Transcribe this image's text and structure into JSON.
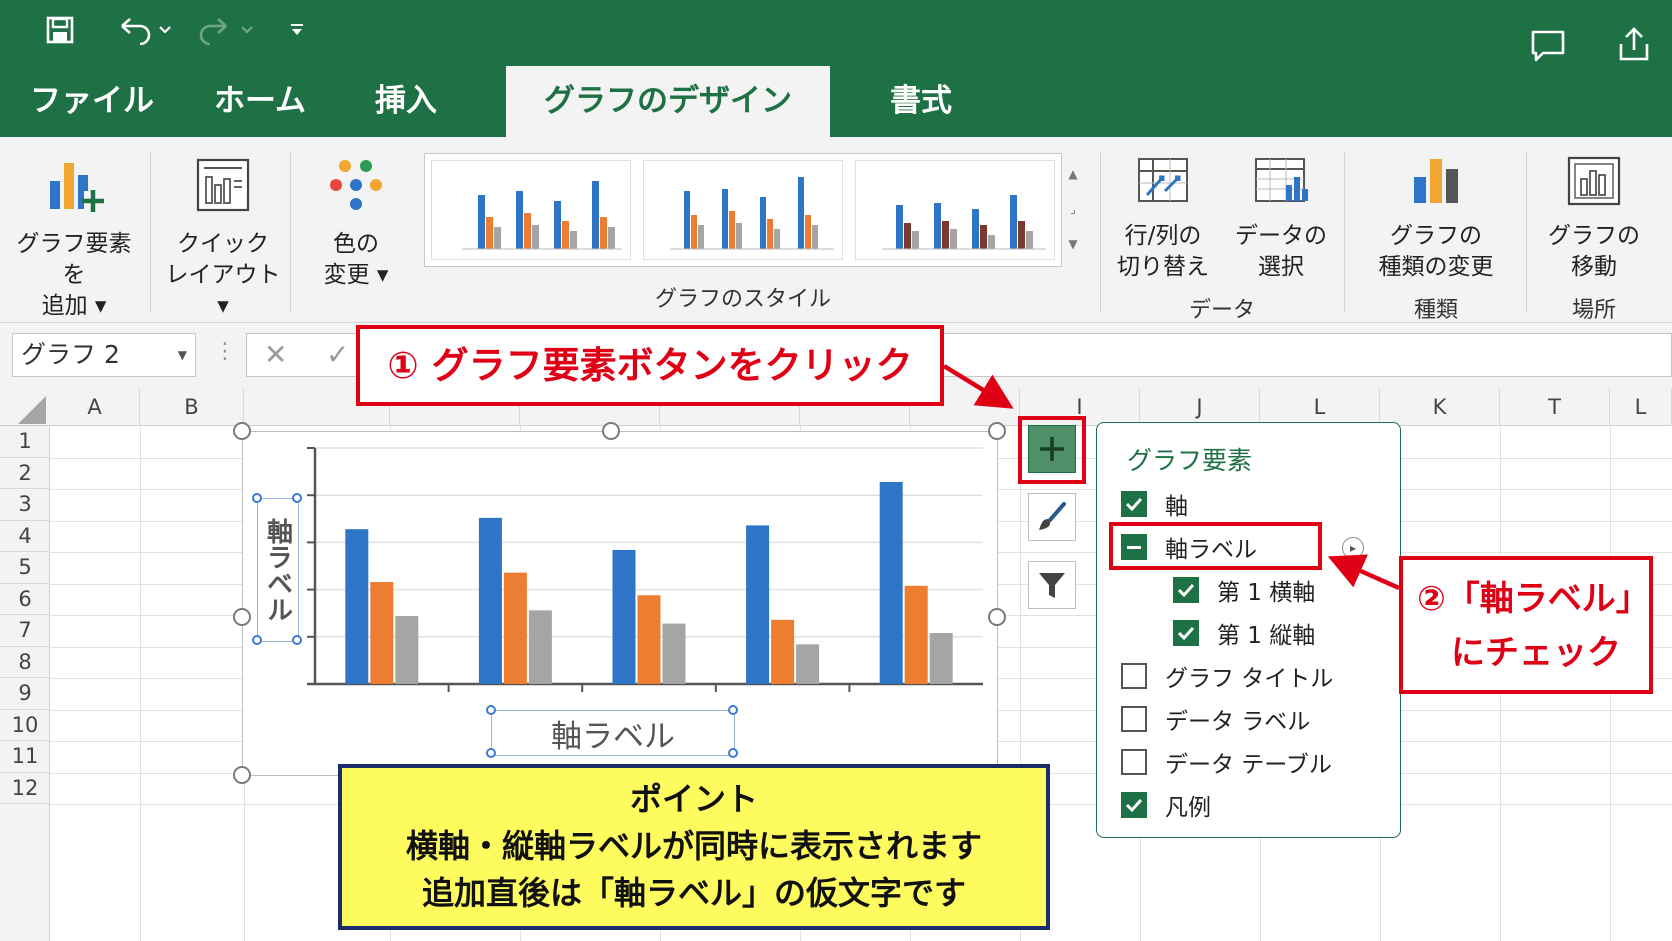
{
  "colors": {
    "excel_green": "#1e7145",
    "series_blue": "#2e75c7",
    "series_orange": "#ed7d31",
    "series_gray": "#a5a5a5",
    "annotation_red": "#e00016",
    "note_yellow": "#fefb5f",
    "note_border": "#1b2c6b"
  },
  "quick_access": {
    "icons": [
      "save-icon",
      "undo-icon",
      "redo-icon",
      "customize-icon",
      "comment-icon",
      "share-icon"
    ]
  },
  "tabs": [
    {
      "label": "ファイル",
      "active": false
    },
    {
      "label": "ホーム",
      "active": false
    },
    {
      "label": "挿入",
      "active": false
    },
    {
      "label": "グラフのデザイン",
      "active": true
    },
    {
      "label": "書式",
      "active": false
    }
  ],
  "ribbon": {
    "add_element": {
      "line1": "グラフ要素を",
      "line2": "追加 ▾"
    },
    "quick_layout": {
      "line1": "クイック",
      "line2": "レイアウト ▾"
    },
    "change_colors": {
      "line1": "色の",
      "line2": "変更 ▾"
    },
    "styles_group_label": "グラフのスタイル",
    "switch_row_col": {
      "line1": "行/列の",
      "line2": "切り替え"
    },
    "select_data": {
      "line1": "データの",
      "line2": "選択"
    },
    "data_group_label": "データ",
    "change_type": {
      "line1": "グラフの",
      "line2": "種類の変更"
    },
    "type_group_label": "種類",
    "move_chart": {
      "line1": "グラフの",
      "line2": "移動"
    },
    "location_group_label": "場所"
  },
  "formula_bar": {
    "name_box": "グラフ 2",
    "cancel_symbol": "✕",
    "enter_symbol": "✓"
  },
  "sheet": {
    "columns": [
      "A",
      "B",
      "",
      "",
      "",
      "",
      "",
      "",
      "I",
      "J",
      "L",
      "K",
      "T",
      "L"
    ],
    "rows": [
      "1",
      "2",
      "3",
      "4",
      "5",
      "6",
      "7",
      "8",
      "9",
      "10",
      "11",
      "12"
    ]
  },
  "chart": {
    "vertical_axis_label": "軸ラベル",
    "horizontal_axis_label": "軸ラベル"
  },
  "chart_data": {
    "type": "bar",
    "categories": [
      "",
      "",
      "",
      "",
      ""
    ],
    "series": [
      {
        "values": [
          82,
          88,
          71,
          84,
          107
        ]
      },
      {
        "values": [
          54,
          59,
          47,
          34,
          52
        ]
      },
      {
        "values": [
          36,
          39,
          32,
          21,
          27
        ]
      }
    ],
    "ylim": [
      0,
      125
    ],
    "grid": true,
    "legend": "none"
  },
  "chart_elements_panel": {
    "title": "グラフ要素",
    "options": [
      {
        "label": "軸",
        "state": "checked",
        "indent": 0
      },
      {
        "label": "軸ラベル",
        "state": "mixed",
        "indent": 0
      },
      {
        "label": "第 1 横軸",
        "state": "checked",
        "indent": 1
      },
      {
        "label": "第 1 縦軸",
        "state": "checked",
        "indent": 1
      },
      {
        "label": "グラフ タイトル",
        "state": "unchecked",
        "indent": 0
      },
      {
        "label": "データ ラベル",
        "state": "unchecked",
        "indent": 0
      },
      {
        "label": "データ テーブル",
        "state": "unchecked",
        "indent": 0
      },
      {
        "label": "凡例",
        "state": "checked",
        "indent": 0
      }
    ]
  },
  "annotations": {
    "step1": "① グラフ要素ボタンをクリック",
    "step2_line1": "②「軸ラベル」",
    "step2_line2": "にチェック",
    "note_title": "ポイント",
    "note_line1": "横軸・縦軸ラベルが同時に表示されます",
    "note_line2": "追加直後は「軸ラベル」の仮文字です"
  }
}
